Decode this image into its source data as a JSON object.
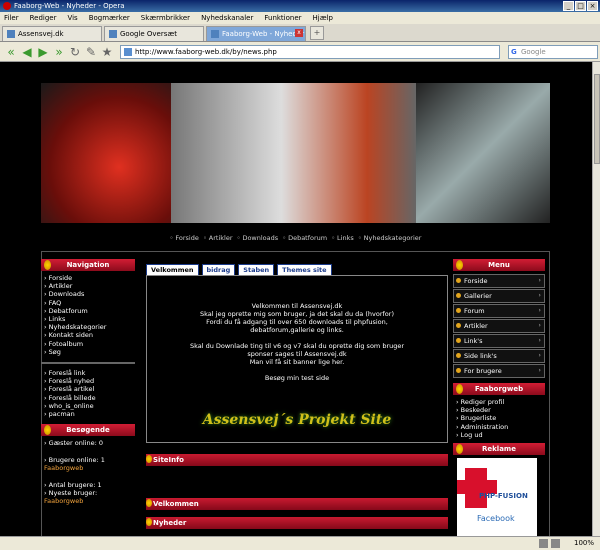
{
  "window": {
    "title": "Faaborg-Web - Nyheder - Opera"
  },
  "menubar": [
    "Filer",
    "Rediger",
    "Vis",
    "Bogmærker",
    "Skærmbrikker",
    "Nyhedskanaler",
    "Funktioner",
    "Hjælp"
  ],
  "tabs": [
    {
      "label": "Assensvej.dk",
      "active": false
    },
    {
      "label": "Google Oversæt",
      "active": false
    },
    {
      "label": "Faaborg-Web - Nyheder",
      "active": true
    }
  ],
  "address": {
    "url": "http://www.faaborg-web.dk/by/news.php",
    "search_placeholder": "Google"
  },
  "topnav": [
    "Forside",
    "Artikler",
    "Downloads",
    "Debatforum",
    "Links",
    "Nyhedskategorier"
  ],
  "left": {
    "nav_title": "Navigation",
    "nav_links": [
      "Forside",
      "Artikler",
      "Downloads",
      "FAQ",
      "Debatforum",
      "Links",
      "Nyhedskategorier",
      "Kontakt siden",
      "Fotoalbum",
      "Søg"
    ],
    "suggest_links": [
      "Foreslå link",
      "Foreslå nyhed",
      "Foreslå artikel",
      "Foreslå billede",
      "who_is_online",
      "pacman"
    ],
    "visitors_title": "Besøgende",
    "guests": "Gæster online: 0",
    "users_online_label": "Brugere online: 1",
    "users_online_name": "Faaborgweb",
    "total_users": "Antal brugere: 1",
    "newest_label": "Nyeste bruger:",
    "newest_name": "Faaborgweb"
  },
  "center": {
    "tabs": [
      "Velkommen",
      "bidrag",
      "Staben",
      "Themes site"
    ],
    "welcome_lines": [
      "Velkommen til Assensvej.dk",
      "Skal jeg oprette mig som bruger, ja det skal du da (hvorfor)",
      "Fordi du få adgang til over 650 downloads til phpfusion,",
      "debatforum,gallerie og links.",
      "Skal du Downlade ting til v6 og v7 skal du oprette dig som bruger",
      "sponser sages til Assensvej.dk",
      "Man vil få sit banner lige her.",
      "Besøg min test side"
    ],
    "site_banner": "Assensvej´s Projekt Site",
    "bars": [
      "SiteInfo",
      "Velkommen",
      "Nyheder"
    ]
  },
  "right": {
    "menu_title": "Menu",
    "menu_items": [
      "Forside",
      "Gallerier",
      "Forum",
      "Artikler",
      "Link's",
      "Side link's",
      "For brugere"
    ],
    "fw_title": "Faaborgweb",
    "fw_links": [
      "Rediger profil",
      "Beskeder",
      "Brugerliste",
      "Administration",
      "Log ud"
    ],
    "ad_title": "Reklame",
    "ad_php": "PHP-FUSION",
    "ad_fb": "Facebook"
  },
  "status": {
    "zoom": "100%"
  },
  "colors": {
    "accent_red": "#c91a30",
    "page_bg": "#000000",
    "link_orange": "#f2a33c"
  }
}
